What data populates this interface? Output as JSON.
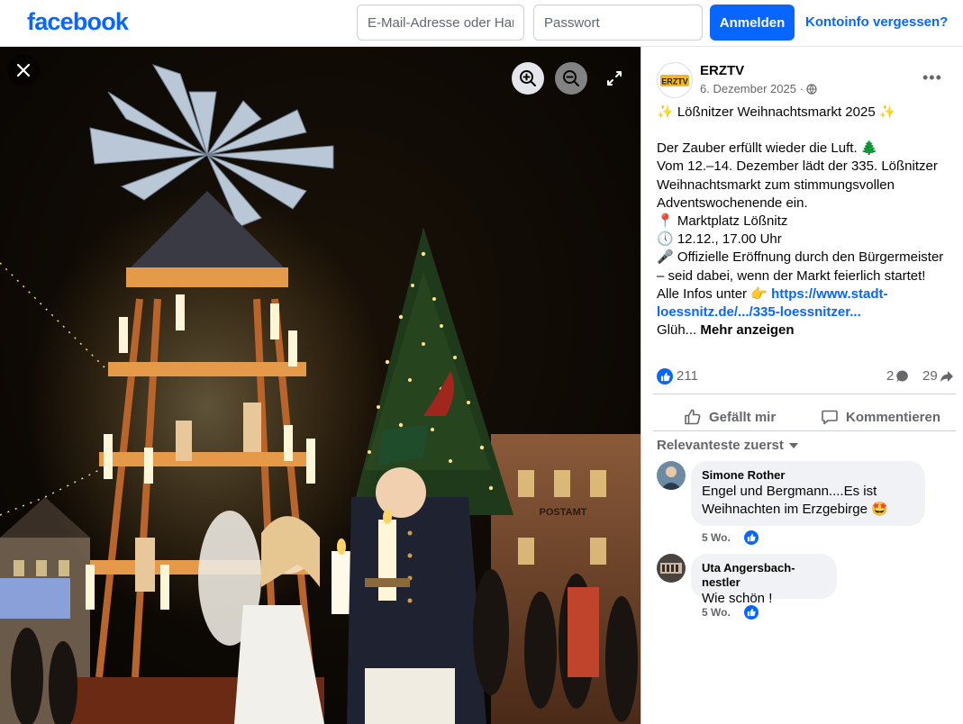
{
  "topbar": {
    "logo": "facebook",
    "email_placeholder": "E-Mail-Adresse oder Handynummer",
    "password_placeholder": "Passwort",
    "login_label": "Anmelden",
    "forgot_label": "Kontoinfo vergessen?"
  },
  "viewer": {
    "sign_text": "POSTAMT",
    "icons": [
      "close-icon",
      "zoom-in-icon",
      "zoom-out-icon",
      "fullscreen-icon"
    ]
  },
  "post": {
    "author": "ERZTV",
    "avatar_text": "ERZTV",
    "date": "6. Dezember 2025 ·",
    "lines": {
      "title": "✨ Lößnitzer Weihnachtsmarkt 2025 ✨",
      "l1": "Der Zauber erfüllt wieder die Luft. 🌲",
      "l2": "Vom 12.–14. Dezember lädt der 335. Lößnitzer Weihnachtsmarkt zum stimmungsvollen Adventswochenende ein.",
      "l3": "📍 Marktplatz Lößnitz",
      "l4": "🕔 12.12., 17.00 Uhr",
      "l5": "🎤 Offizielle Eröffnung durch den Bürgermeister – seid dabei, wenn der Markt feierlich startet!",
      "l6_prefix": "Alle Infos unter 👉 ",
      "l6_link": "https://www.stadt-loessnitz.de/.../335-loessnitzer...",
      "l7_prefix": "Glüh... ",
      "see_more": "Mehr anzeigen"
    }
  },
  "stats": {
    "likes": "211",
    "comments": "2",
    "shares": "29"
  },
  "actions": {
    "like_label": "Gefällt mir",
    "comment_label": "Kommentieren"
  },
  "comments": {
    "sort_label": "Relevanteste zuerst",
    "items": [
      {
        "name": "Simone Rother",
        "text": "Engel und Bergmann....Es ist Weihnachten im Erzgebirge 🤩",
        "time": "5 Wo."
      },
      {
        "name": "Uta Angersbach-nestler",
        "text": "Wie schön !",
        "time": "5 Wo."
      }
    ]
  },
  "colors": {
    "brand": "#0866ff",
    "text_secondary": "#65676b",
    "bubble": "#f0f2f5"
  }
}
